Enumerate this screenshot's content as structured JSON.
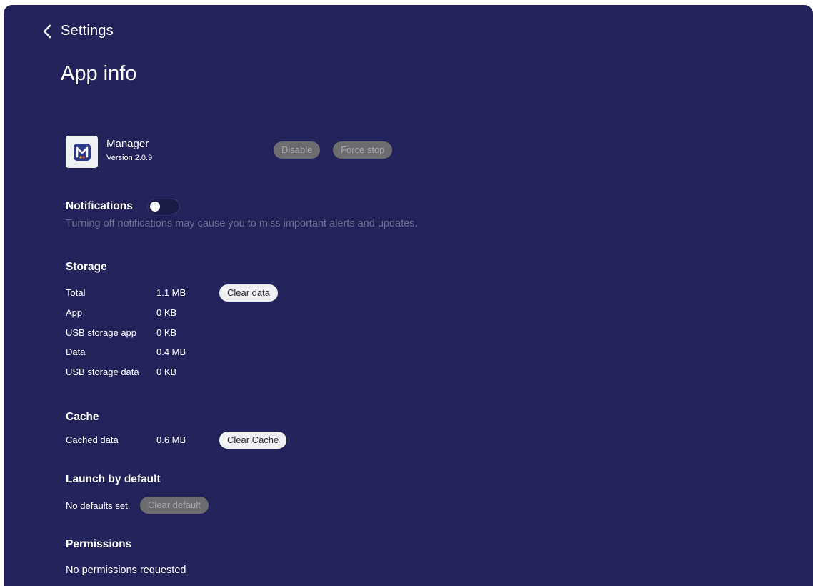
{
  "header": {
    "back_icon": "chevron-left-icon",
    "title": "Settings"
  },
  "page": {
    "title": "App info"
  },
  "app": {
    "icon": "manager-app-icon",
    "name": "Manager",
    "version": "Version 2.0.9",
    "disable_label": "Disable",
    "force_stop_label": "Force stop"
  },
  "notifications": {
    "heading": "Notifications",
    "enabled": false,
    "description": "Turning off notifications may cause you to miss important alerts and updates."
  },
  "storage": {
    "heading": "Storage",
    "clear_data_label": "Clear data",
    "rows": [
      {
        "label": "Total",
        "value": "1.1 MB"
      },
      {
        "label": "App",
        "value": "0 KB"
      },
      {
        "label": "USB storage app",
        "value": "0 KB"
      },
      {
        "label": "Data",
        "value": "0.4 MB"
      },
      {
        "label": "USB storage data",
        "value": "0 KB"
      }
    ]
  },
  "cache": {
    "heading": "Cache",
    "label": "Cached data",
    "value": "0.6 MB",
    "clear_cache_label": "Clear Cache"
  },
  "launch_default": {
    "heading": "Launch by default",
    "text": "No defaults set.",
    "clear_default_label": "Clear default"
  },
  "permissions": {
    "heading": "Permissions",
    "text": "No permissions requested"
  },
  "colors": {
    "background": "#24225a",
    "muted_text": "#6f6e96",
    "disabled_button": "#6d6d70",
    "enabled_button": "#f0f0f2"
  }
}
